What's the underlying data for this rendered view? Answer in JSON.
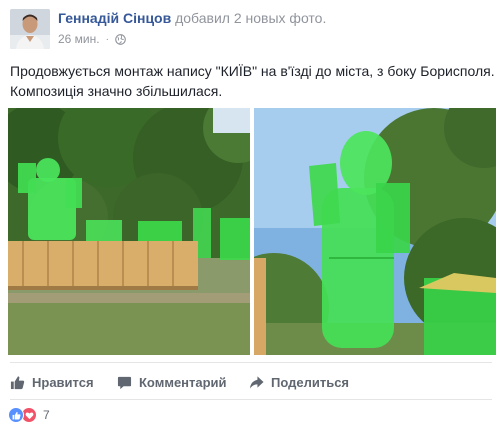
{
  "post": {
    "author": "Геннадій Сінцов",
    "action": "добавил 2 новых фото.",
    "time": "26 мин.",
    "separator": "·",
    "privacy_icon": "globe-icon",
    "text_line1": "Продовжується монтаж напису \"КИЇВ\" на в'їзді до міста, з боку Борисполя.",
    "text_line2": "Композиція значно збільшилася."
  },
  "actions": {
    "like_label": "Нравится",
    "comment_label": "Комментарий",
    "share_label": "Поделиться"
  },
  "reactions": {
    "icons": [
      "like-icon",
      "love-icon"
    ],
    "count": "7"
  },
  "colors": {
    "author": "#365899",
    "muted": "#90949c",
    "like_blue": "#5890ff",
    "love_red": "#f25268",
    "sign_green": "#3ddc4a"
  }
}
